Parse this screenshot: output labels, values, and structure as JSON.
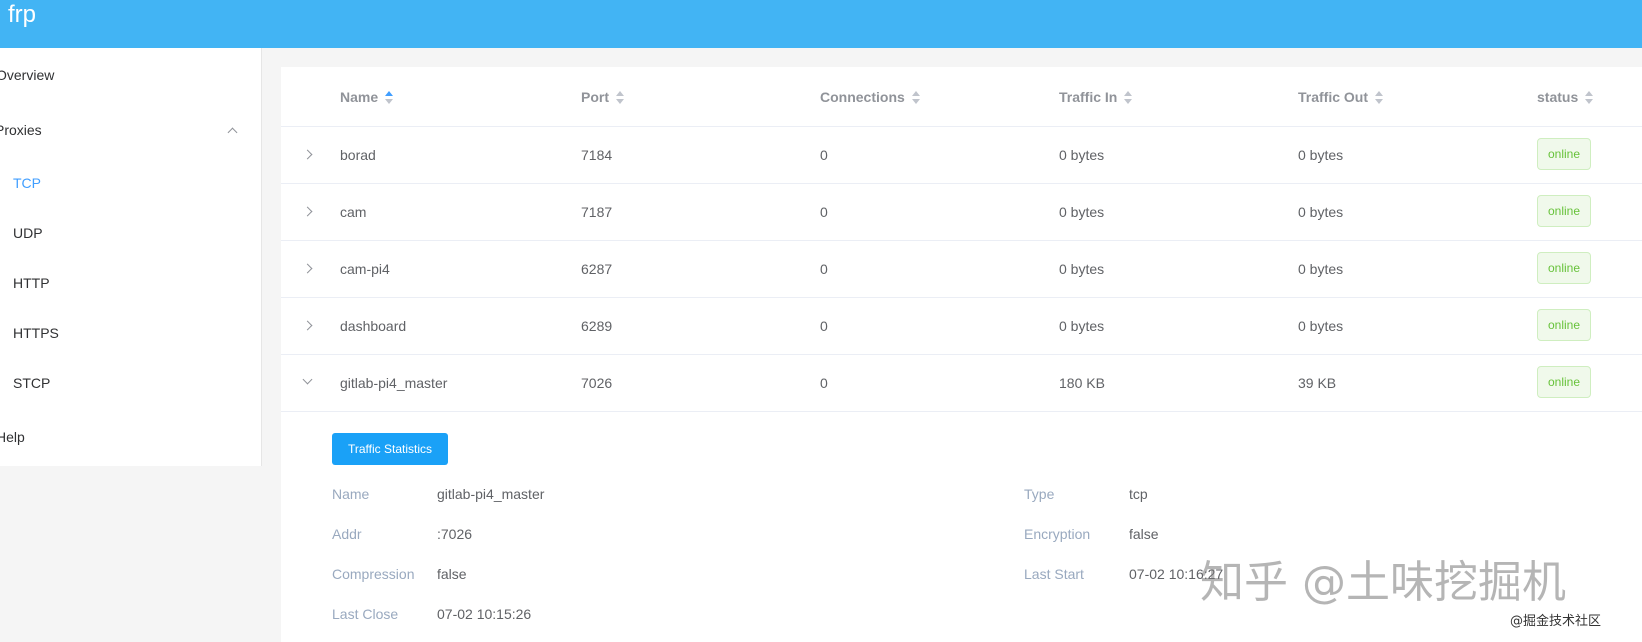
{
  "app": {
    "brand": "frp"
  },
  "sidebar": {
    "overview": "Overview",
    "proxies": "Proxies",
    "sub_items": [
      "TCP",
      "UDP",
      "HTTP",
      "HTTPS",
      "STCP"
    ],
    "help": "Help"
  },
  "table": {
    "headers": [
      "Name",
      "Port",
      "Connections",
      "Traffic In",
      "Traffic Out",
      "status"
    ],
    "rows": [
      {
        "name": "borad",
        "port": "7184",
        "connections": "0",
        "traffic_in": "0 bytes",
        "traffic_out": "0 bytes",
        "status": "online"
      },
      {
        "name": "cam",
        "port": "7187",
        "connections": "0",
        "traffic_in": "0 bytes",
        "traffic_out": "0 bytes",
        "status": "online"
      },
      {
        "name": "cam-pi4",
        "port": "6287",
        "connections": "0",
        "traffic_in": "0 bytes",
        "traffic_out": "0 bytes",
        "status": "online"
      },
      {
        "name": "dashboard",
        "port": "6289",
        "connections": "0",
        "traffic_in": "0 bytes",
        "traffic_out": "0 bytes",
        "status": "online"
      },
      {
        "name": "gitlab-pi4_master",
        "port": "7026",
        "connections": "0",
        "traffic_in": "180 KB",
        "traffic_out": "39 KB",
        "status": "online"
      }
    ]
  },
  "detail": {
    "button": "Traffic Statistics",
    "left": [
      {
        "label": "Name",
        "value": "gitlab-pi4_master"
      },
      {
        "label": "Addr",
        "value": ":7026"
      },
      {
        "label": "Compression",
        "value": "false"
      },
      {
        "label": "Last Close",
        "value": "07-02 10:15:26"
      }
    ],
    "right": [
      {
        "label": "Type",
        "value": "tcp"
      },
      {
        "label": "Encryption",
        "value": "false"
      },
      {
        "label": "Last Start",
        "value": "07-02 10:16:27"
      }
    ]
  },
  "watermark": {
    "main": "知乎 @土味挖掘机",
    "sub": "@掘金技术社区"
  },
  "colors": {
    "header": "#42b4f4",
    "active": "#409eff",
    "online": "#67c23a",
    "button": "#1aa1f7"
  }
}
